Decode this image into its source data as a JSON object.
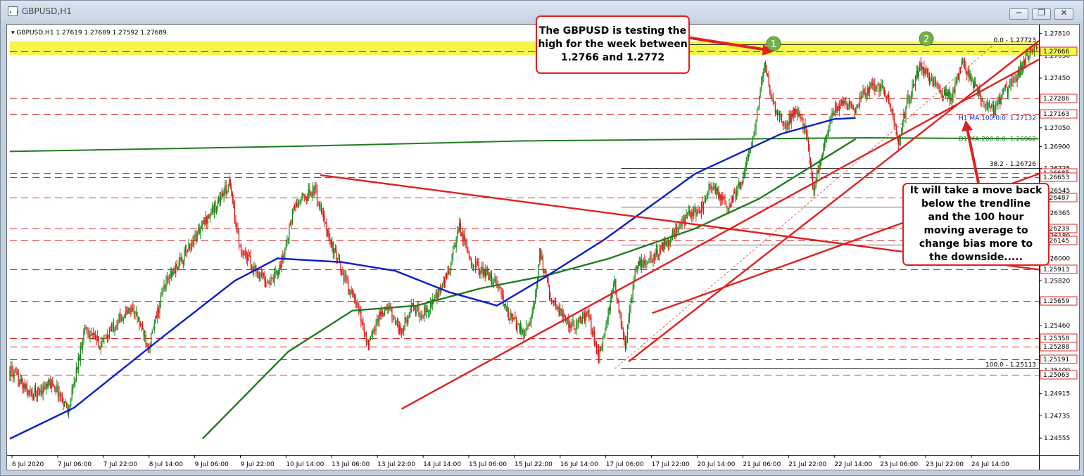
{
  "window": {
    "title": "GBPUSD,H1",
    "buttons": [
      "minimize",
      "restore",
      "close"
    ]
  },
  "header": {
    "symbol_line": "GBPUSD,H1  1.27619 1.27689 1.27592 1.27689"
  },
  "chart_data": {
    "type": "candlestick",
    "symbol": "GBPUSD",
    "timeframe": "H1",
    "ohlc_current": {
      "open": 1.27619,
      "high": 1.27689,
      "low": 1.27592,
      "close": 1.27689
    },
    "ylim": [
      1.2442,
      1.2788
    ],
    "y_ticks": [
      "1.27810",
      "1.27630",
      "1.27450",
      "1.27050",
      "1.26900",
      "1.26725",
      "1.26545",
      "1.26365",
      "1.26180",
      "1.26000",
      "1.25820",
      "1.25640",
      "1.25460",
      "1.25280",
      "1.25100",
      "1.24915",
      "1.24735",
      "1.24555"
    ],
    "x_ticks": [
      "6 Jul 2020",
      "7 Jul 06:00",
      "7 Jul 22:00",
      "8 Jul 14:00",
      "9 Jul 06:00",
      "9 Jul 22:00",
      "10 Jul 14:00",
      "13 Jul 06:00",
      "13 Jul 22:00",
      "14 Jul 14:00",
      "15 Jul 06:00",
      "15 Jul 22:00",
      "16 Jul 14:00",
      "17 Jul 06:00",
      "17 Jul 22:00",
      "20 Jul 14:00",
      "21 Jul 06:00",
      "21 Jul 22:00",
      "22 Jul 14:00",
      "23 Jul 06:00",
      "23 Jul 22:00",
      "24 Jul 14:00"
    ],
    "price_anchors": [
      [
        0,
        1.251
      ],
      [
        20,
        1.249
      ],
      [
        40,
        1.25
      ],
      [
        55,
        1.2478
      ],
      [
        70,
        1.2545
      ],
      [
        85,
        1.253
      ],
      [
        100,
        1.255
      ],
      [
        115,
        1.256
      ],
      [
        130,
        1.253
      ],
      [
        145,
        1.258
      ],
      [
        160,
        1.2598
      ],
      [
        175,
        1.262
      ],
      [
        190,
        1.264
      ],
      [
        205,
        1.266
      ],
      [
        215,
        1.261
      ],
      [
        230,
        1.259
      ],
      [
        245,
        1.258
      ],
      [
        255,
        1.26
      ],
      [
        265,
        1.264
      ],
      [
        275,
        1.265
      ],
      [
        285,
        1.2655
      ],
      [
        295,
        1.2625
      ],
      [
        305,
        1.26
      ],
      [
        315,
        1.258
      ],
      [
        325,
        1.256
      ],
      [
        335,
        1.253
      ],
      [
        345,
        1.2555
      ],
      [
        355,
        1.256
      ],
      [
        365,
        1.254
      ],
      [
        375,
        1.256
      ],
      [
        385,
        1.2555
      ],
      [
        400,
        1.257
      ],
      [
        410,
        1.259
      ],
      [
        420,
        1.2625
      ],
      [
        430,
        1.26
      ],
      [
        440,
        1.259
      ],
      [
        455,
        1.258
      ],
      [
        465,
        1.2555
      ],
      [
        480,
        1.254
      ],
      [
        490,
        1.256
      ],
      [
        495,
        1.2605
      ],
      [
        505,
        1.257
      ],
      [
        515,
        1.2555
      ],
      [
        525,
        1.2545
      ],
      [
        540,
        1.2555
      ],
      [
        550,
        1.252
      ],
      [
        565,
        1.258
      ],
      [
        575,
        1.253
      ],
      [
        585,
        1.2595
      ],
      [
        600,
        1.26
      ],
      [
        610,
        1.261
      ],
      [
        620,
        1.262
      ],
      [
        635,
        1.2635
      ],
      [
        645,
        1.264
      ],
      [
        655,
        1.266
      ],
      [
        670,
        1.264
      ],
      [
        685,
        1.2665
      ],
      [
        695,
        1.27
      ],
      [
        705,
        1.2755
      ],
      [
        715,
        1.2718
      ],
      [
        725,
        1.2708
      ],
      [
        735,
        1.272
      ],
      [
        745,
        1.27
      ],
      [
        750,
        1.2655
      ],
      [
        760,
        1.269
      ],
      [
        770,
        1.272
      ],
      [
        780,
        1.2725
      ],
      [
        790,
        1.2722
      ],
      [
        800,
        1.2735
      ],
      [
        810,
        1.274
      ],
      [
        820,
        1.273
      ],
      [
        830,
        1.2695
      ],
      [
        840,
        1.273
      ],
      [
        850,
        1.2755
      ],
      [
        860,
        1.2745
      ],
      [
        870,
        1.2733
      ],
      [
        880,
        1.273
      ],
      [
        890,
        1.2758
      ],
      [
        900,
        1.274
      ],
      [
        910,
        1.2725
      ],
      [
        920,
        1.272
      ],
      [
        930,
        1.2735
      ],
      [
        940,
        1.2745
      ],
      [
        950,
        1.2762
      ],
      [
        960,
        1.2769
      ]
    ],
    "series": [
      {
        "name": "H1 MA:100:0:0: 1.27132",
        "color": "#0a1ec8",
        "values": [
          [
            0,
            1.2455
          ],
          [
            60,
            1.248
          ],
          [
            140,
            1.2535
          ],
          [
            210,
            1.2582
          ],
          [
            250,
            1.26
          ],
          [
            310,
            1.2597
          ],
          [
            360,
            1.259
          ],
          [
            410,
            1.2573
          ],
          [
            455,
            1.2562
          ],
          [
            500,
            1.2585
          ],
          [
            555,
            1.2615
          ],
          [
            640,
            1.2668
          ],
          [
            720,
            1.27
          ],
          [
            770,
            1.2712
          ],
          [
            790,
            1.2713
          ]
        ]
      },
      {
        "name": "D1 MA:200:0:0: 1.26962",
        "color": "#1f7d1f",
        "values": [
          [
            180,
            1.2455
          ],
          [
            260,
            1.2525
          ],
          [
            320,
            1.2558
          ],
          [
            380,
            1.2562
          ],
          [
            440,
            1.2576
          ],
          [
            500,
            1.2586
          ],
          [
            560,
            1.26
          ],
          [
            640,
            1.2624
          ],
          [
            700,
            1.2648
          ],
          [
            790,
            1.2696
          ]
        ]
      },
      {
        "name": "",
        "color": "#1f7d1f",
        "values": [
          [
            0,
            1.2686
          ],
          [
            260,
            1.269
          ],
          [
            480,
            1.26945
          ],
          [
            800,
            1.2697
          ],
          [
            961,
            1.26962
          ]
        ]
      }
    ],
    "horizontal_levels": [
      1.27666,
      1.27286,
      1.27163,
      1.26685,
      1.26653,
      1.26487,
      1.26239,
      1.26145,
      1.25913,
      1.25659,
      1.25358,
      1.25288,
      1.25191,
      1.25063
    ],
    "level_labels": [
      "1.27666",
      "1.27286",
      "1.27163",
      "1.26685",
      "1.26653",
      "1.26487",
      "1.26239",
      "1.26145",
      "1.25913",
      "1.25659",
      "1.25358",
      "1.25288",
      "1.25191",
      "1.25063"
    ],
    "highlight_zone": [
      1.2766,
      1.27723
    ],
    "fibonacci": {
      "from": 1.25113,
      "to": 1.27723,
      "labels": [
        "0.0 - 1.27723",
        "38.2 - 1.26726",
        "100.0 - 1.25113"
      ]
    },
    "ma_labels": [
      "H1 MA:100:0:0: 1.27132",
      "D1 MA:200:0:0: 1.26962"
    ],
    "annotations": [
      "The GBPUSD is testing the high for the week between 1.2766 and 1.2772",
      "It will take a move back below the trendline and the 100 hour moving average to change bias more to the downside....."
    ],
    "markers": [
      "1",
      "2"
    ],
    "grid": false,
    "background": "#ffffff",
    "up_color": "#118811",
    "down_color": "#dd1111"
  }
}
